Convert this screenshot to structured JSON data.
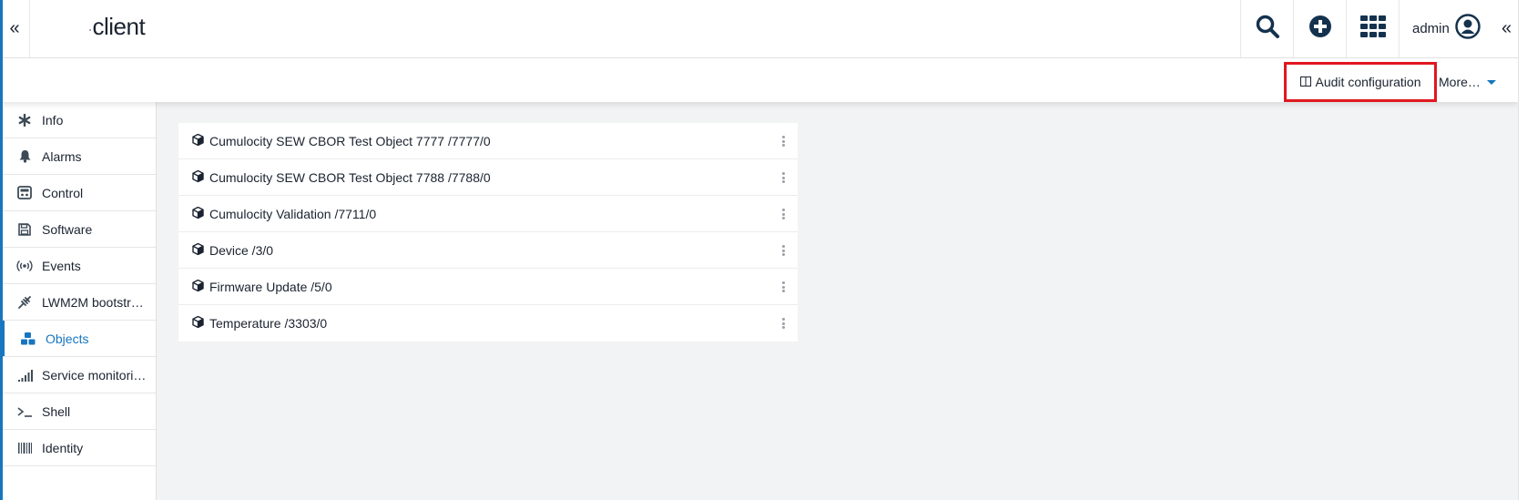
{
  "header": {
    "brand": "client",
    "user_name": "admin"
  },
  "action_bar": {
    "audit_label": "Audit configuration",
    "more_label": "More…"
  },
  "sidebar": {
    "items": [
      {
        "label": "Info",
        "icon": "asterisk-icon",
        "active": false
      },
      {
        "label": "Alarms",
        "icon": "bell-icon",
        "active": false
      },
      {
        "label": "Control",
        "icon": "control-panel-icon",
        "active": false
      },
      {
        "label": "Software",
        "icon": "floppy-disk-icon",
        "active": false
      },
      {
        "label": "Events",
        "icon": "broadcast-icon",
        "active": false
      },
      {
        "label": "LWM2M bootstr…",
        "icon": "plug-icon",
        "active": false
      },
      {
        "label": "Objects",
        "icon": "cubes-icon",
        "active": true
      },
      {
        "label": "Service monitori…",
        "icon": "signal-bars-icon",
        "active": false
      },
      {
        "label": "Shell",
        "icon": "terminal-icon",
        "active": false
      },
      {
        "label": "Identity",
        "icon": "barcode-icon",
        "active": false
      }
    ]
  },
  "objects": {
    "items": [
      "Cumulocity SEW CBOR Test Object 7777 /7777/0",
      "Cumulocity SEW CBOR Test Object 7788 /7788/0",
      "Cumulocity Validation /7711/0",
      "Device /3/0",
      "Firmware Update /5/0",
      "Temperature /3303/0"
    ]
  },
  "colors": {
    "accent": "#1776bf",
    "highlight_border": "#e0171f",
    "header_icons": "#14324e",
    "background": "#f2f3f4"
  }
}
